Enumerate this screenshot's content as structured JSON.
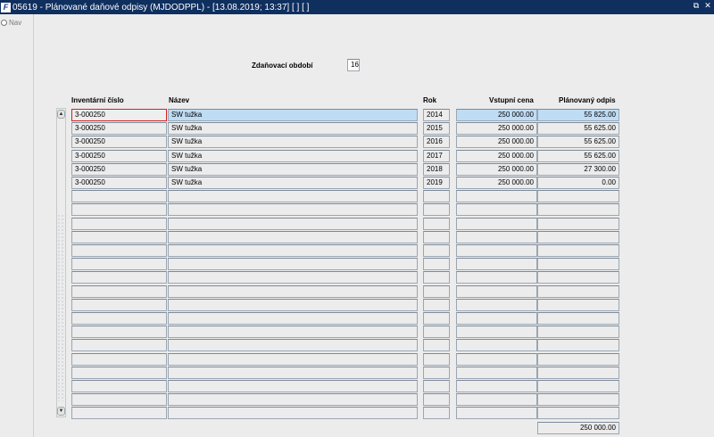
{
  "window": {
    "app_icon": "F",
    "title": "05619 - Plánované daňové odpisy (MJDODPPL) - [13.08.2019; 13:37]  [ ]  [ ]",
    "controls": [
      "restore-icon",
      "close-icon"
    ],
    "restore_glyph": "⧉",
    "close_glyph": "✕"
  },
  "nav": {
    "label": "Nav"
  },
  "header": {
    "period_label": "Zdaňovací období",
    "period_value": "16"
  },
  "columns": {
    "inventory": "Inventární číslo",
    "name": "Název",
    "year": "Rok",
    "price": "Vstupní cena",
    "planned": "Plánovaný odpis"
  },
  "rows": [
    {
      "inventory": "3-000250",
      "name": "SW tužka",
      "year": "2014",
      "price": "250 000.00",
      "planned": "55 825.00"
    },
    {
      "inventory": "3-000250",
      "name": "SW tužka",
      "year": "2015",
      "price": "250 000.00",
      "planned": "55 625.00"
    },
    {
      "inventory": "3-000250",
      "name": "SW tužka",
      "year": "2016",
      "price": "250 000.00",
      "planned": "55 625.00"
    },
    {
      "inventory": "3-000250",
      "name": "SW tužka",
      "year": "2017",
      "price": "250 000.00",
      "planned": "55 625.00"
    },
    {
      "inventory": "3-000250",
      "name": "SW tužka",
      "year": "2018",
      "price": "250 000.00",
      "planned": "27 300.00"
    },
    {
      "inventory": "3-000250",
      "name": "SW tužka",
      "year": "2019",
      "price": "250 000.00",
      "planned": "0.00"
    }
  ],
  "total": "250 000.00",
  "scroll": {
    "up": "▲",
    "down": "▼"
  }
}
